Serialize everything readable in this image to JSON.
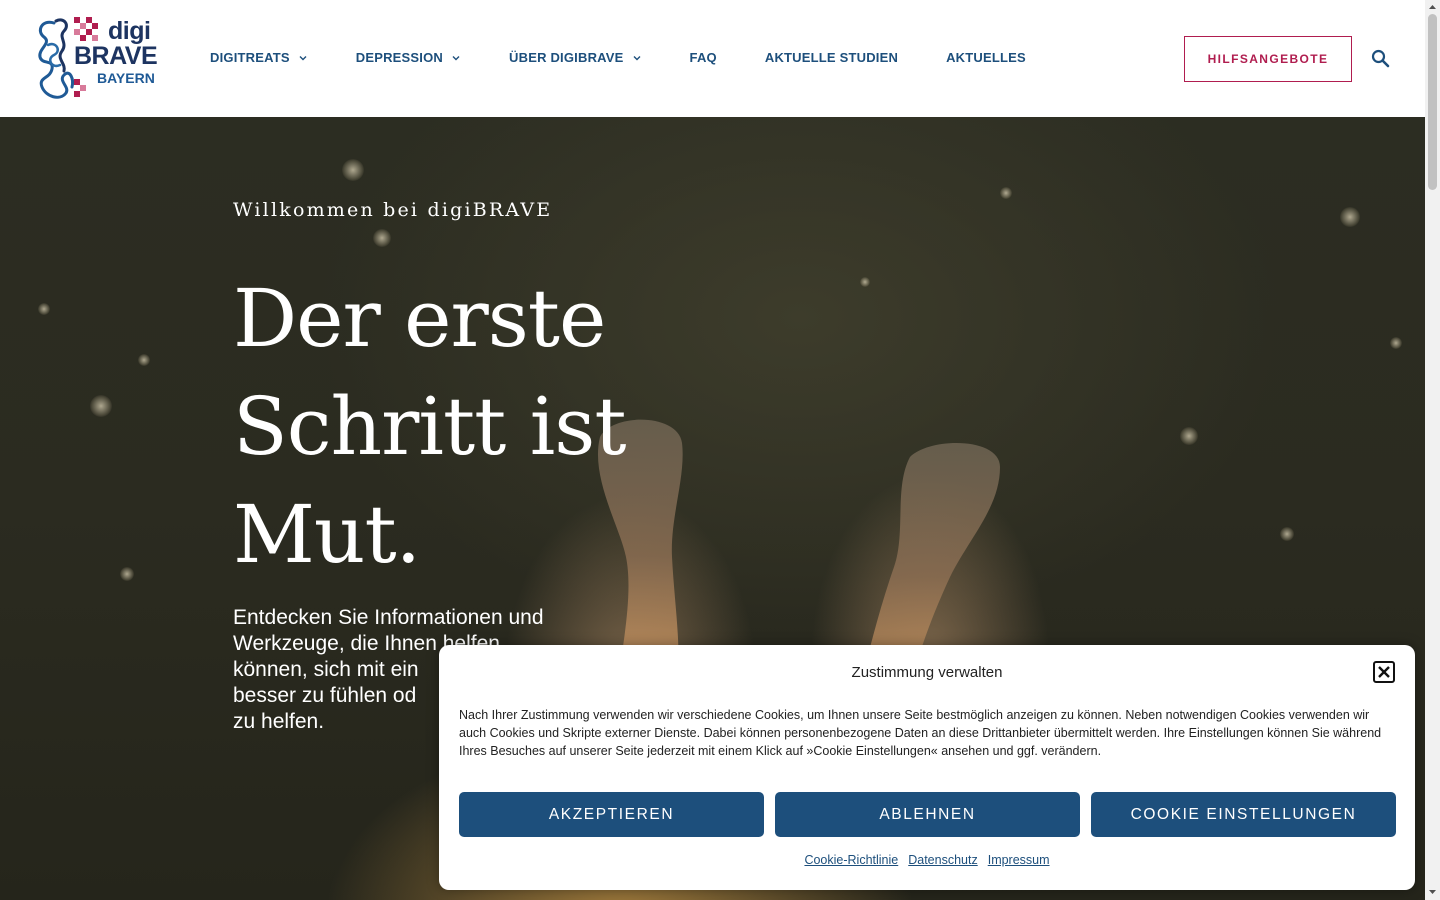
{
  "header": {
    "logo": {
      "line1": "digi",
      "line2": "BRAVE",
      "line3": "BAYERN",
      "icon": "digibrave-logo-icon"
    },
    "nav": [
      {
        "label": "DIGITREATS",
        "has_dropdown": true
      },
      {
        "label": "DEPRESSION",
        "has_dropdown": true
      },
      {
        "label": "ÜBER DIGIBRAVE",
        "has_dropdown": true
      },
      {
        "label": "FAQ",
        "has_dropdown": false
      },
      {
        "label": "AKTUELLE STUDIEN",
        "has_dropdown": false
      },
      {
        "label": "AKTUELLES",
        "has_dropdown": false
      }
    ],
    "help_button": "HILFSANGEBOTE",
    "search_icon": "search-icon"
  },
  "hero": {
    "eyebrow": "Willkommen bei digiBRAVE",
    "title_lines": [
      "Der erste",
      "Schritt ist",
      "Mut."
    ],
    "text": "Entdecken Sie Informationen und Werkzeuge, die Ihnen helfen können, sich mit ein besser zu fühlen od zu helfen.",
    "text_lines": [
      "Entdecken Sie Informationen und",
      "Werkzeuge, die Ihnen helfen",
      "können, sich mit ein",
      "besser zu fühlen od",
      "zu helfen."
    ]
  },
  "cookie": {
    "title": "Zustimmung verwalten",
    "close_icon": "close-icon",
    "body": "Nach Ihrer Zustimmung verwenden wir verschiedene Cookies, um Ihnen unsere Seite bestmöglich anzeigen zu können. Neben notwendigen Cookies verwenden wir auch Cookies und Skripte externer Dienste. Dabei können personenbezogene Daten an diese Drittanbieter übermittelt werden. Ihre Einstellungen können Sie während Ihres Besuches auf unserer Seite jederzeit mit einem Klick auf »Cookie Einstellungen« ansehen und ggf. verändern.",
    "buttons": {
      "accept": "AKZEPTIEREN",
      "decline": "ABLEHNEN",
      "settings": "COOKIE EINSTELLUNGEN"
    },
    "links": [
      "Cookie-Richtlinie",
      "Datenschutz",
      "Impressum"
    ]
  },
  "colors": {
    "primary": "#1d4f7c",
    "accent": "#b01d4f",
    "logo_dark": "#1d3461"
  }
}
